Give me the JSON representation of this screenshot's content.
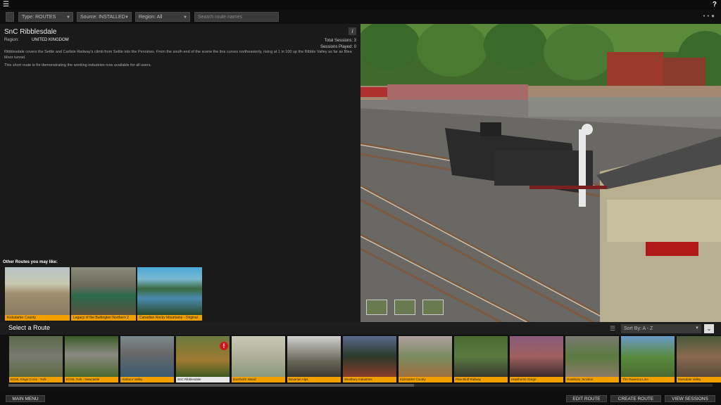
{
  "topbar": {
    "menu_icon": "hamburger-icon",
    "help": "?"
  },
  "filters": {
    "type": "Type: ROUTES",
    "source": "Source: INSTALLED",
    "region": "Region: All",
    "search_placeholder": "Search route names",
    "icons": [
      "profile-icon",
      "camera-icon",
      "avatar-icon"
    ]
  },
  "route": {
    "title": "SnC Ribblesdale",
    "region_label": "Region:",
    "region_value": "UNITED KINGDOM",
    "sessions_total": "Total Sessions: 3",
    "sessions_played": "Sessions Played: 0",
    "description": "Ribblesdale covers the Settle and Carlisle Railway's climb from Settle into the Pennines. From the south end of the scene the line curves northeasterly, rising at 1 in 100 up the Ribble Valley as far as Blea Moor tunnel.",
    "note": "This short route is for demonstrating the working industries now available for all users."
  },
  "others": {
    "label": "Other Routes you may like:",
    "items": [
      {
        "caption": "Kickstarter County"
      },
      {
        "caption": "Legacy of the Burlington Northern 2"
      },
      {
        "caption": "Canadian Rocky Mountains - Original"
      }
    ]
  },
  "routes": {
    "title": "Select a Route",
    "sort": "Sort By: A - Z",
    "items": [
      {
        "caption": "ECML Kings Cross - York"
      },
      {
        "caption": "ECML York - Newcastle"
      },
      {
        "caption": "Harbour Valley"
      },
      {
        "caption": "SnC Ribblesdale",
        "selected": true
      },
      {
        "caption": "Bornholm Island"
      },
      {
        "caption": "Bavarian Alps"
      },
      {
        "caption": "Westbury Industries"
      },
      {
        "caption": "Kickstarter County"
      },
      {
        "caption": "Pine Bluff Railway"
      },
      {
        "caption": "Hawthorne Gorge"
      },
      {
        "caption": "Rosebury Junction"
      },
      {
        "caption": "The Ravenna Line"
      },
      {
        "caption": "Mossdale Valley"
      }
    ]
  },
  "bottom": {
    "main_menu": "MAIN MENU",
    "edit_route": "EDIT ROUTE",
    "create_route": "CREATE ROUTE",
    "view_sessions": "VIEW SESSIONS"
  },
  "colors": {
    "accent": "#f0a000",
    "alert": "#d0161b",
    "background": "#161616"
  }
}
